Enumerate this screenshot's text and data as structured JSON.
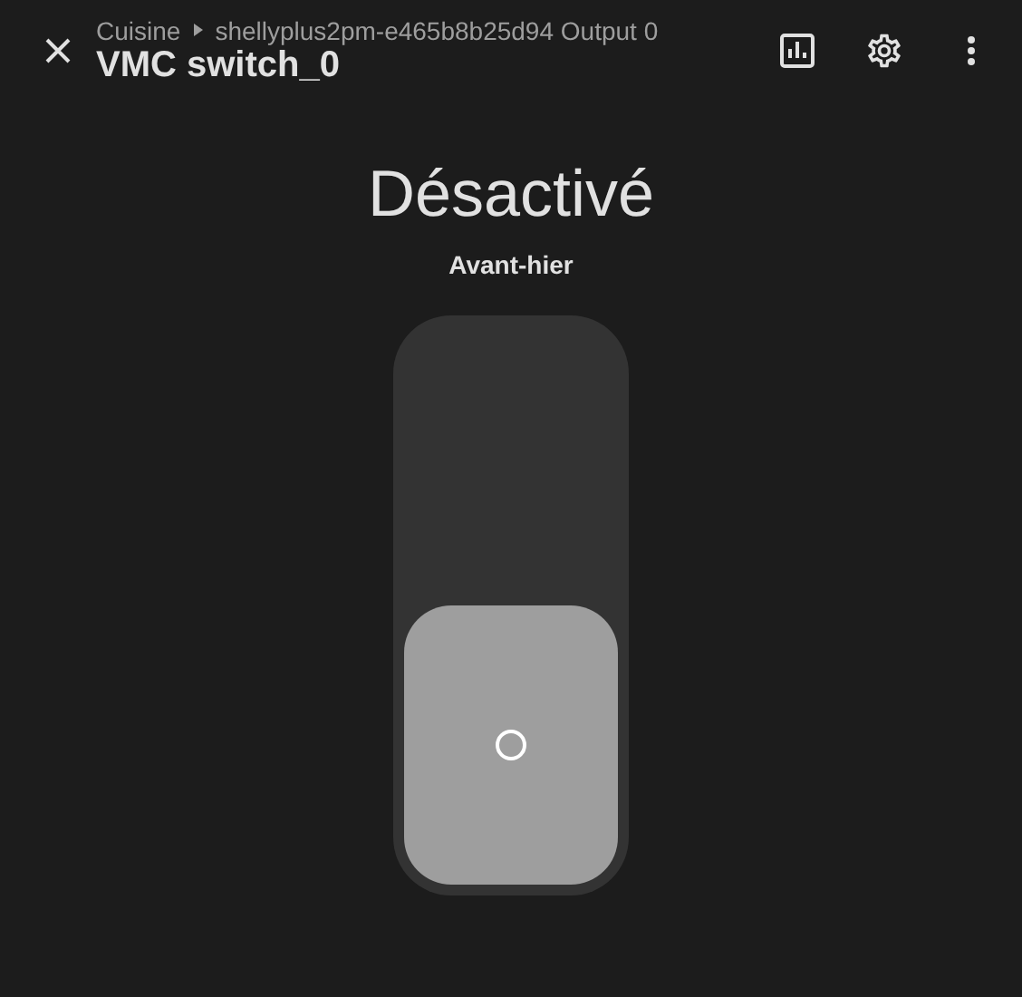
{
  "header": {
    "breadcrumb": [
      "Cuisine",
      "shellyplus2pm-e465b8b25d94 Output 0"
    ],
    "title": "VMC switch_0"
  },
  "state": {
    "label": "Désactivé",
    "last_changed": "Avant-hier"
  },
  "switch": {
    "on": false
  }
}
